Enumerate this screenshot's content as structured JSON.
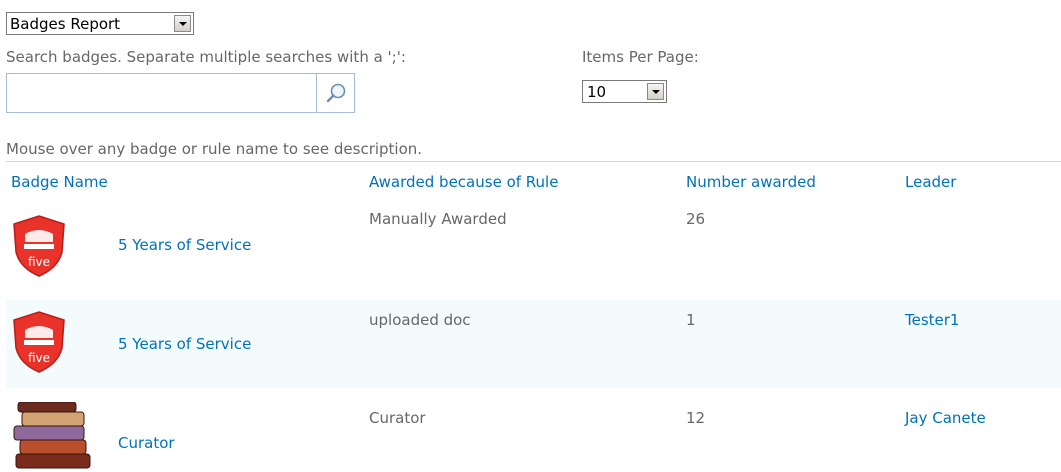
{
  "report_select": {
    "value": "Badges Report",
    "icon": "chevron-down-icon"
  },
  "search": {
    "label": "Search badges. Separate multiple searches with a ';':",
    "value": "",
    "icon": "search-icon"
  },
  "items_per_page": {
    "label": "Items Per Page:",
    "value": "10"
  },
  "hint": "Mouse over any badge or rule name to see description.",
  "table": {
    "headers": {
      "badge_name": "Badge Name",
      "rule": "Awarded because of Rule",
      "number": "Number awarded",
      "leader": "Leader"
    },
    "rows": [
      {
        "badge": "5 Years of Service",
        "icon": "five-years-badge-icon",
        "rule": "Manually Awarded",
        "number": "26",
        "leader": ""
      },
      {
        "badge": "5 Years of Service",
        "icon": "five-years-badge-icon",
        "rule": "uploaded doc",
        "number": "1",
        "leader": "Tester1"
      },
      {
        "badge": "Curator",
        "icon": "books-stack-icon",
        "rule": "Curator",
        "number": "12",
        "leader": "Jay Canete"
      }
    ]
  },
  "colors": {
    "link": "#0072bc",
    "text": "#676767",
    "alt_row": "#f3fbfd",
    "badge_red": "#e8322a"
  }
}
